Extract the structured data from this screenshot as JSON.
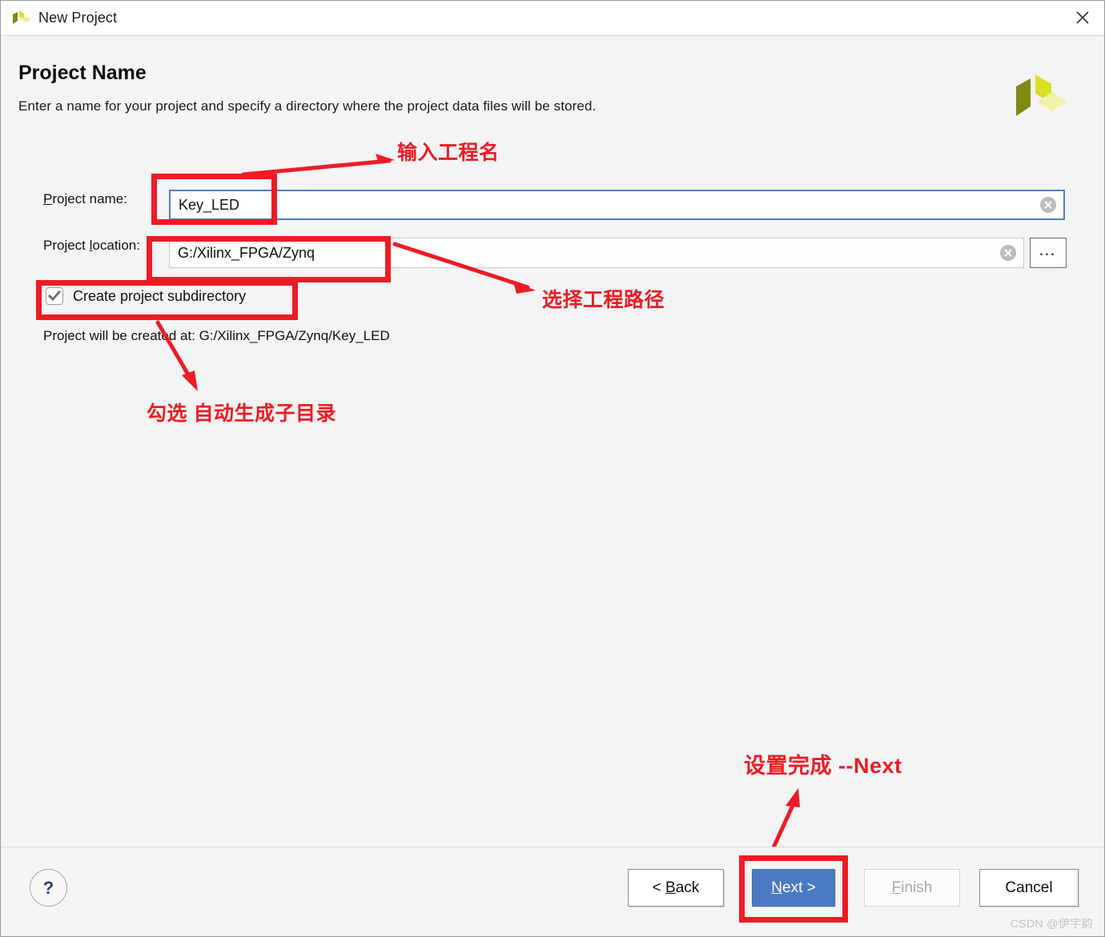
{
  "window": {
    "title": "New Project",
    "logo_icon": "vivado-logo-icon",
    "close_icon": "close-icon"
  },
  "page": {
    "title": "Project Name",
    "subtitle": "Enter a name for your project and specify a directory where the project data files will be stored.",
    "brand_logo_icon": "xilinx-logo-icon"
  },
  "form": {
    "project_name": {
      "label_prefix": "P",
      "label_rest": "roject name:",
      "value": "Key_LED",
      "clear_icon": "clear-circle-icon"
    },
    "project_location": {
      "label_prefix": "Project ",
      "label_accel": "l",
      "label_rest": "ocation:",
      "value": "G:/Xilinx_FPGA/Zynq",
      "clear_icon": "clear-circle-icon",
      "browse_label": "…"
    },
    "create_subdirectory": {
      "label": "Create project subdirectory",
      "checked": true
    },
    "created_at": "Project will be created at: G:/Xilinx_FPGA/Zynq/Key_LED"
  },
  "annotations": [
    {
      "id": "enter-project-name",
      "text": "输入工程名"
    },
    {
      "id": "select-project-path",
      "text": "选择工程路径"
    },
    {
      "id": "check-subdirectory",
      "text": "勾选 自动生成子目录"
    },
    {
      "id": "settings-done-next",
      "text": "设置完成 --Next"
    }
  ],
  "footer": {
    "help_label": "?",
    "back": {
      "accel": "B",
      "before": "< ",
      "after": "ack"
    },
    "next": {
      "accel": "N",
      "before": "",
      "after": "ext >"
    },
    "finish": {
      "accel": "F",
      "before": "",
      "after": "inish"
    },
    "cancel": {
      "label": "Cancel"
    },
    "watermark": "CSDN @伊宇韵"
  },
  "colors": {
    "annotation_red": "#ed1c24",
    "primary_blue": "#4a7ac4",
    "focus_border": "#4f7fc1",
    "logo_dark": "#7d8b13",
    "logo_bright": "#d7e023",
    "logo_pale": "#eef2a8"
  }
}
